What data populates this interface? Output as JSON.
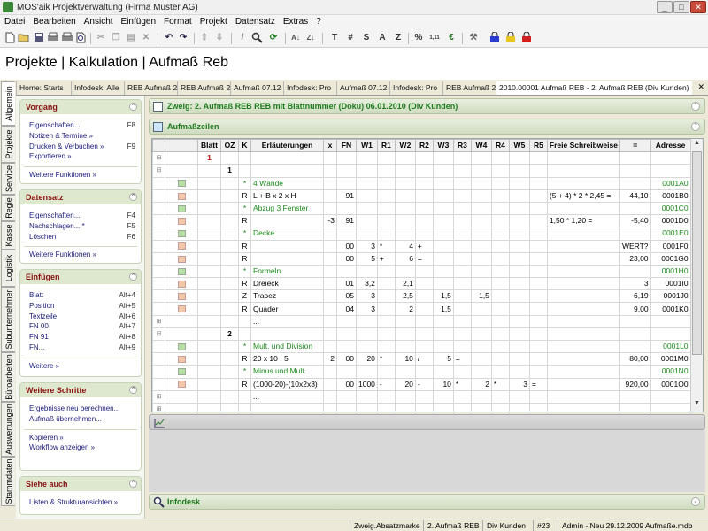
{
  "window": {
    "title": "MOS'aik Projektverwaltung (Firma Muster AG)",
    "min": "_",
    "max": "□",
    "close": "✕"
  },
  "menu": [
    "Datei",
    "Bearbeiten",
    "Ansicht",
    "Einfügen",
    "Format",
    "Projekt",
    "Datensatz",
    "Extras",
    "?"
  ],
  "toolbar_text": {
    "t": "T",
    "hash": "#",
    "s": "S",
    "a": "A",
    "z": "Z",
    "pct": "%",
    "num": "1,11",
    "euro": "€"
  },
  "page_title": "Projekte | Kalkulation | Aufmaß Reb",
  "vertical_tabs": [
    "Allgemein",
    "Projekte",
    "Service",
    "Regie",
    "Kasse",
    "Logistik",
    "Subunternehmer",
    "Büroarbeiten",
    "Auswertungen",
    "Stammdaten"
  ],
  "doc_tabs": [
    "Home: Starts",
    "Infodesk: Alle",
    "REB Aufmaß 2",
    "REB Aufmaß 2",
    "Aufmaß 07.12",
    "Infodesk: Pro",
    "Aufmaß 07.12",
    "Infodesk: Pro",
    "REB Aufmaß 2",
    "2010.00001 Aufmaß REB - 2. Aufmaß REB (Div Kunden)"
  ],
  "doc_tab_close": "✕",
  "sidebar": {
    "vorgang": {
      "title": "Vorgang",
      "items": [
        {
          "label": "Eigenschaften...",
          "key": "F8"
        },
        {
          "label": "Notizen & Termine »",
          "key": ""
        },
        {
          "label": "Drucken & Verbuchen »",
          "key": "F9"
        },
        {
          "label": "Exportieren »",
          "key": ""
        }
      ],
      "more": "Weitere Funktionen »"
    },
    "datensatz": {
      "title": "Datensatz",
      "items": [
        {
          "label": "Eigenschaften...",
          "key": "F4"
        },
        {
          "label": "Nachschlagen... *",
          "key": "F5"
        },
        {
          "label": "Löschen",
          "key": "F6"
        }
      ],
      "more": "Weitere Funktionen »"
    },
    "einfuegen": {
      "title": "Einfügen",
      "items": [
        {
          "label": "Blatt",
          "key": "Alt+4"
        },
        {
          "label": "Position",
          "key": "Alt+5"
        },
        {
          "label": "Textzeile",
          "key": "Alt+6"
        },
        {
          "label": "FN 00",
          "key": "Alt+7"
        },
        {
          "label": "FN 91",
          "key": "Alt+8"
        },
        {
          "label": "FN...",
          "key": "Alt+9"
        }
      ],
      "more": "Weitere »"
    },
    "schritte": {
      "title": "Weitere Schritte",
      "items": [
        {
          "label": "Ergebnisse neu berechnen...",
          "key": ""
        },
        {
          "label": "Aufmaß übernehmen...",
          "key": ""
        }
      ],
      "items2": [
        {
          "label": "Kopieren »",
          "key": ""
        },
        {
          "label": "Workflow anzeigen »",
          "key": ""
        }
      ]
    },
    "siehe": {
      "title": "Siehe auch",
      "items": [
        {
          "label": "Listen & Strukturansichten »",
          "key": ""
        }
      ]
    }
  },
  "branch_bar": "Zweig: 2. Aufmaß REB REB mit Blattnummer (Doku) 06.01.2010 (Div Kunden)",
  "section_aufmass": "Aufmaßzeilen",
  "section_infodesk": "Infodesk",
  "grid": {
    "columns": [
      "",
      "",
      "Blatt",
      "OZ",
      "K",
      "Erläuterungen",
      "x",
      "FN",
      "W1",
      "R1",
      "W2",
      "R2",
      "W3",
      "R3",
      "W4",
      "R4",
      "W5",
      "R5",
      "Freie Schreibweise",
      "=",
      "Adresse"
    ],
    "rows": [
      {
        "tree": "⊟",
        "sq": "",
        "cells": [
          "1",
          "",
          "",
          "",
          "",
          "",
          "",
          "",
          "",
          "",
          "",
          "",
          "",
          "",
          "",
          "",
          "",
          "",
          ""
        ]
      },
      {
        "tree": "⊟",
        "sq": "",
        "cells": [
          "",
          "1",
          "",
          "",
          "",
          "",
          "",
          "",
          "",
          "",
          "",
          "",
          "",
          "",
          "",
          "",
          "",
          "",
          ""
        ]
      },
      {
        "tree": "",
        "sq": "g",
        "cells": [
          "",
          "",
          "*",
          "4 Wände",
          "",
          "",
          "",
          "",
          "",
          "",
          "",
          "",
          "",
          "",
          "",
          "",
          "",
          "",
          "0001A0"
        ]
      },
      {
        "tree": "",
        "sq": "o",
        "cells": [
          "",
          "",
          "R",
          "L + B x 2 x H",
          "",
          "91",
          "",
          "",
          "",
          "",
          "",
          "",
          "",
          "",
          "",
          "",
          "(5 + 4) * 2 * 2,45 =",
          "44,10",
          "0001B0"
        ]
      },
      {
        "tree": "",
        "sq": "g",
        "cells": [
          "",
          "",
          "*",
          "Abzug 3 Fenster",
          "",
          "",
          "",
          "",
          "",
          "",
          "",
          "",
          "",
          "",
          "",
          "",
          "",
          "",
          "0001C0"
        ]
      },
      {
        "tree": "",
        "sq": "o",
        "cells": [
          "",
          "",
          "R",
          "",
          "-3",
          "91",
          "",
          "",
          "",
          "",
          "",
          "",
          "",
          "",
          "",
          "",
          "1,50 * 1,20 =",
          "-5,40",
          "0001D0"
        ]
      },
      {
        "tree": "",
        "sq": "g",
        "cells": [
          "",
          "",
          "*",
          "Decke",
          "",
          "",
          "",
          "",
          "",
          "",
          "",
          "",
          "",
          "",
          "",
          "",
          "",
          "",
          "0001E0"
        ]
      },
      {
        "tree": "",
        "sq": "o",
        "cells": [
          "",
          "",
          "R",
          "",
          "",
          "00",
          "3",
          "*",
          "4",
          "+",
          "",
          "",
          "",
          "",
          "",
          "",
          "",
          "WERT?",
          "0001F0"
        ]
      },
      {
        "tree": "",
        "sq": "o",
        "cells": [
          "",
          "",
          "R",
          "",
          "",
          "00",
          "5",
          "+",
          "6",
          "=",
          "",
          "",
          "",
          "",
          "",
          "",
          "",
          "23,00",
          "0001G0"
        ]
      },
      {
        "tree": "",
        "sq": "g",
        "cells": [
          "",
          "",
          "*",
          "Formeln",
          "",
          "",
          "",
          "",
          "",
          "",
          "",
          "",
          "",
          "",
          "",
          "",
          "",
          "",
          "0001H0"
        ]
      },
      {
        "tree": "",
        "sq": "o",
        "cells": [
          "",
          "",
          "R",
          "Dreieck",
          "",
          "01",
          "3,2",
          "",
          "2,1",
          "",
          "",
          "",
          "",
          "",
          "",
          "",
          "",
          "3",
          "0001I0"
        ]
      },
      {
        "tree": "",
        "sq": "o",
        "cells": [
          "",
          "",
          "Z",
          "Trapez",
          "",
          "05",
          "3",
          "",
          "2,5",
          "",
          "1,5",
          "",
          "1,5",
          "",
          "",
          "",
          "",
          "6,19",
          "0001J0"
        ]
      },
      {
        "tree": "",
        "sq": "o",
        "cells": [
          "",
          "",
          "R",
          "Quader",
          "",
          "04",
          "3",
          "",
          "2",
          "",
          "1,5",
          "",
          "",
          "",
          "",
          "",
          "",
          "9,00",
          "0001K0"
        ]
      },
      {
        "tree": "⊞",
        "sq": "",
        "cells": [
          "",
          "",
          "",
          "...",
          "",
          "",
          "",
          "",
          "",
          "",
          "",
          "",
          "",
          "",
          "",
          "",
          "",
          "",
          ""
        ]
      },
      {
        "tree": "⊟",
        "sq": "",
        "cells": [
          "",
          "2",
          "",
          "",
          "",
          "",
          "",
          "",
          "",
          "",
          "",
          "",
          "",
          "",
          "",
          "",
          "",
          "",
          ""
        ]
      },
      {
        "tree": "",
        "sq": "g",
        "cells": [
          "",
          "",
          "*",
          "Mult. und Division",
          "",
          "",
          "",
          "",
          "",
          "",
          "",
          "",
          "",
          "",
          "",
          "",
          "",
          "",
          "0001L0"
        ]
      },
      {
        "tree": "",
        "sq": "o",
        "cells": [
          "",
          "",
          "R",
          "20 x 10 : 5",
          "2",
          "00",
          "20",
          "*",
          "10",
          "/",
          "5",
          "=",
          "",
          "",
          "",
          "",
          "",
          "80,00",
          "0001M0"
        ]
      },
      {
        "tree": "",
        "sq": "g",
        "cells": [
          "",
          "",
          "*",
          "Minus und Mult.",
          "",
          "",
          "",
          "",
          "",
          "",
          "",
          "",
          "",
          "",
          "",
          "",
          "",
          "",
          "0001N0"
        ]
      },
      {
        "tree": "",
        "sq": "o",
        "cells": [
          "",
          "",
          "R",
          "(1000-20)-(10x2x3)",
          "",
          "00",
          "1000",
          "-",
          "20",
          "-",
          "10",
          "*",
          "2",
          "*",
          "3",
          "=",
          "",
          "920,00",
          "0001O0"
        ]
      },
      {
        "tree": "⊞",
        "sq": "",
        "cells": [
          "",
          "",
          "",
          "...",
          "",
          "",
          "",
          "",
          "",
          "",
          "",
          "",
          "",
          "",
          "",
          "",
          "",
          "",
          ""
        ]
      },
      {
        "tree": "⊞",
        "sq": "",
        "cells": [
          "",
          "",
          "",
          "",
          "",
          "",
          "",
          "",
          "",
          "",
          "",
          "",
          "",
          "",
          "",
          "",
          "",
          "",
          ""
        ]
      }
    ]
  },
  "statusbar": [
    "Zweig.Absatzmarke",
    "2. Aufmaß REB",
    "Div Kunden",
    "#23",
    "Admin - Neu 29.12.2009 Aufmaße.mdb"
  ],
  "colors": {
    "accent_green": "#1e8a1e",
    "section_title_red": "#8a1010",
    "link_blue": "#1a1a7a"
  }
}
